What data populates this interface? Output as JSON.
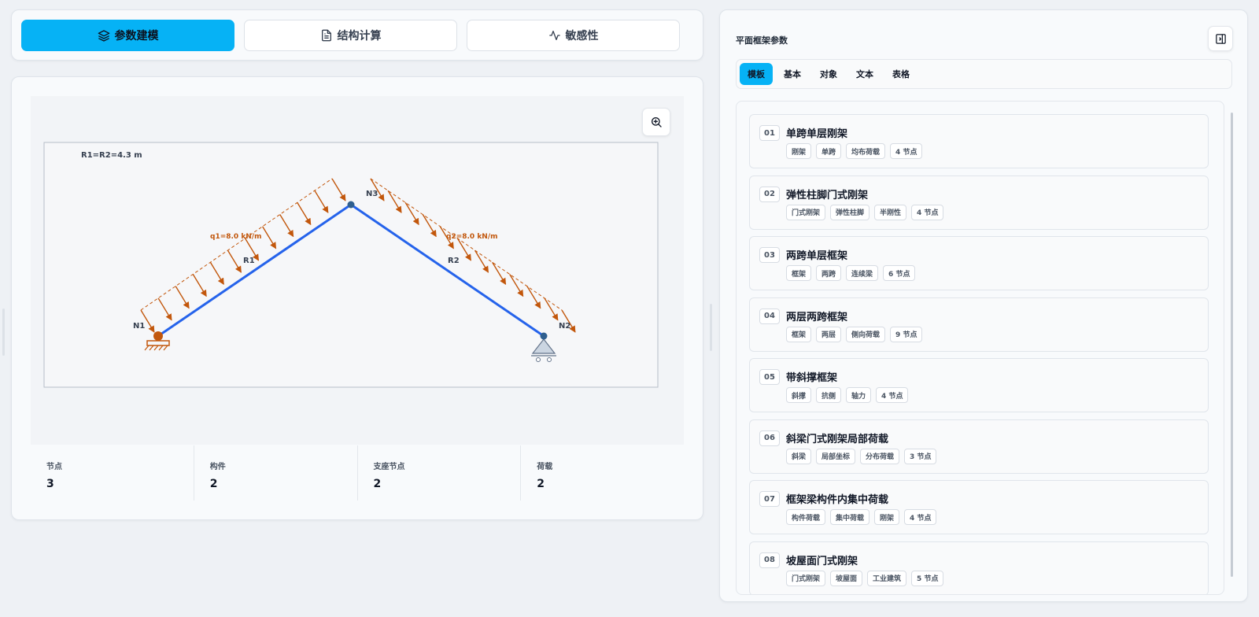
{
  "tabs": [
    {
      "label": "参数建模",
      "icon": "layers-icon",
      "active": true
    },
    {
      "label": "结构计算",
      "icon": "document-icon",
      "active": false
    },
    {
      "label": "敏感性",
      "icon": "pulse-icon",
      "active": false
    }
  ],
  "canvas": {
    "geometry_label": "R1=R2=4.3 m",
    "nodes": [
      "N1",
      "N2",
      "N3"
    ],
    "members": [
      "R1",
      "R2"
    ],
    "loads": [
      "q1=8.0 kN/m",
      "q2=8.0 kN/m"
    ],
    "zoom_icon": "zoom-in-icon",
    "colors": {
      "member": "#2563eb",
      "load": "#c2570c",
      "node": "#2f5f8f",
      "support": "#c2570c"
    }
  },
  "stats": [
    {
      "label": "节点",
      "value": "3"
    },
    {
      "label": "构件",
      "value": "2"
    },
    {
      "label": "支座节点",
      "value": "2"
    },
    {
      "label": "荷载",
      "value": "2"
    }
  ],
  "panel": {
    "title": "平面框架参数",
    "collapse_icon": "panel-right-icon",
    "subtabs": [
      {
        "label": "模板",
        "active": true
      },
      {
        "label": "基本",
        "active": false
      },
      {
        "label": "对象",
        "active": false
      },
      {
        "label": "文本",
        "active": false
      },
      {
        "label": "表格",
        "active": false
      }
    ],
    "templates": [
      {
        "num": "01",
        "title": "单跨单层刚架",
        "tags": [
          "刚架",
          "单跨",
          "均布荷载",
          "4 节点"
        ]
      },
      {
        "num": "02",
        "title": "弹性柱脚门式刚架",
        "tags": [
          "门式刚架",
          "弹性柱脚",
          "半刚性",
          "4 节点"
        ]
      },
      {
        "num": "03",
        "title": "两跨单层框架",
        "tags": [
          "框架",
          "两跨",
          "连续梁",
          "6 节点"
        ]
      },
      {
        "num": "04",
        "title": "两层两跨框架",
        "tags": [
          "框架",
          "两层",
          "侧向荷载",
          "9 节点"
        ]
      },
      {
        "num": "05",
        "title": "带斜撑框架",
        "tags": [
          "斜撑",
          "抗侧",
          "轴力",
          "4 节点"
        ]
      },
      {
        "num": "06",
        "title": "斜梁门式刚架局部荷载",
        "tags": [
          "斜梁",
          "局部坐标",
          "分布荷载",
          "3 节点"
        ]
      },
      {
        "num": "07",
        "title": "框架梁构件内集中荷载",
        "tags": [
          "构件荷载",
          "集中荷载",
          "刚架",
          "4 节点"
        ]
      },
      {
        "num": "08",
        "title": "坡屋面门式刚架",
        "tags": [
          "门式刚架",
          "坡屋面",
          "工业建筑",
          "5 节点"
        ]
      }
    ]
  }
}
